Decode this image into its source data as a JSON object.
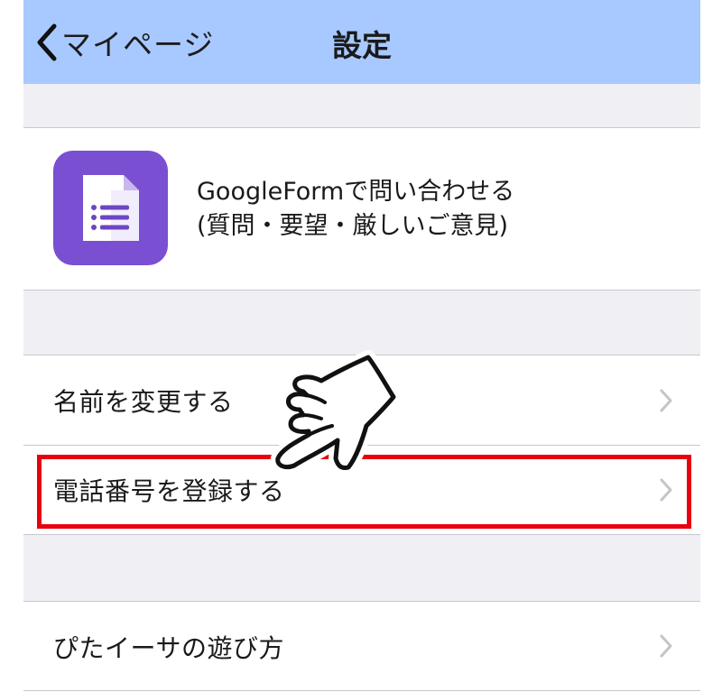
{
  "navbar": {
    "back_label": "マイページ",
    "title": "設定",
    "background": "#a8c9ff"
  },
  "contact": {
    "line1": "GoogleFormで問い合わせる",
    "line2": "(質問・要望・厳しいご意見)",
    "icon": "google-forms-icon",
    "icon_color": "#7a4fd1"
  },
  "settings": {
    "items": [
      {
        "label": "名前を変更する"
      },
      {
        "label": "電話番号を登録する"
      }
    ]
  },
  "help": {
    "items": [
      {
        "label": "ぴたイーサの遊び方"
      }
    ]
  },
  "annotation": {
    "highlight_color": "#e8000f",
    "pointer_icon": "pointing-hand-icon"
  }
}
